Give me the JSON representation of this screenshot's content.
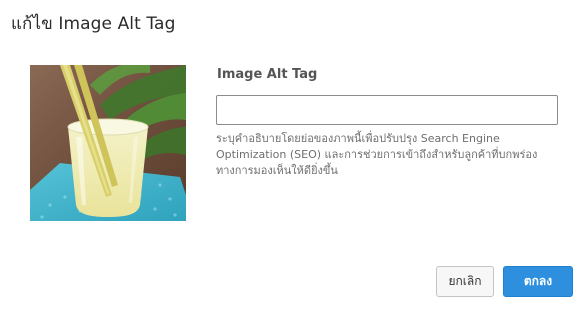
{
  "dialog": {
    "title": "แก้ไข Image Alt Tag"
  },
  "image": {
    "icon": "lemongrass-drink-photo"
  },
  "alt_field": {
    "label": "Image Alt Tag",
    "value": "",
    "placeholder": "",
    "help": "ระบุคำอธิบายโดยย่อของภาพนี้เพื่อปรับปรุง Search Engine Optimization (SEO) และการช่วยการเข้าถึงสำหรับลูกค้าที่บกพร่องทางการมองเห็นให้ดียิ่งขึ้น"
  },
  "buttons": {
    "cancel_label": "ยกเลิก",
    "ok_label": "ตกลง"
  },
  "colors": {
    "primary": "#2d8fde",
    "cancel_bg": "#f7f7f7",
    "border": "#8c8c8c"
  }
}
